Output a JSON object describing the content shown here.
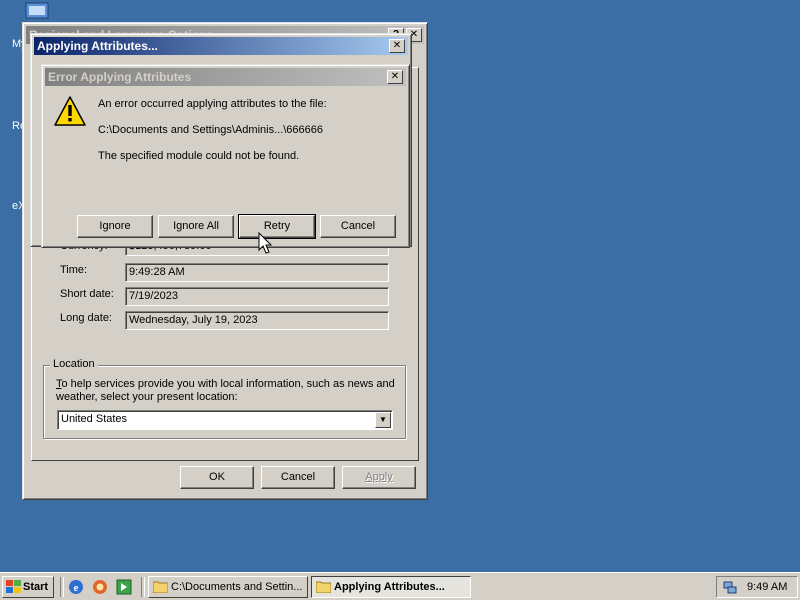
{
  "desktop": {
    "icons": [
      {
        "label": "My",
        "icon": "my-computer-icon"
      },
      {
        "label": "Re",
        "icon": "recycle-bin-icon"
      },
      {
        "label": "eX",
        "icon": "explorer-icon"
      }
    ]
  },
  "regional_window": {
    "title": "Regional and Language Options",
    "currency_label": "Currency:",
    "currency_value": "$123,456,789.00",
    "time_label": "Time:",
    "time_value": "9:49:28 AM",
    "short_date_label": "Short date:",
    "short_date_value": "7/19/2023",
    "long_date_label": "Long date:",
    "long_date_value": "Wednesday, July 19, 2023",
    "location_group": "Location",
    "location_text_1": "o help services provide you with local information, such as news and",
    "location_text_access": "T",
    "location_text_2": "weather, select your present location:",
    "location_value": "United States",
    "ok_label": "OK",
    "cancel_label": "Cancel",
    "apply_label": "Apply"
  },
  "applying_window": {
    "title": "Applying Attributes..."
  },
  "error_dialog": {
    "title": "Error Applying Attributes",
    "line1": "An error occurred applying attributes to the file:",
    "line2": "C:\\Documents and Settings\\Adminis...\\666666",
    "line3": "The specified module could not be found.",
    "buttons": {
      "ignore": "Ignore",
      "ignore_all": "Ignore All",
      "retry": "Retry",
      "cancel": "Cancel"
    }
  },
  "taskbar": {
    "start_label": "Start",
    "task1": "C:\\Documents and Settin...",
    "task2": "Applying Attributes...",
    "clock": "9:49 AM"
  }
}
